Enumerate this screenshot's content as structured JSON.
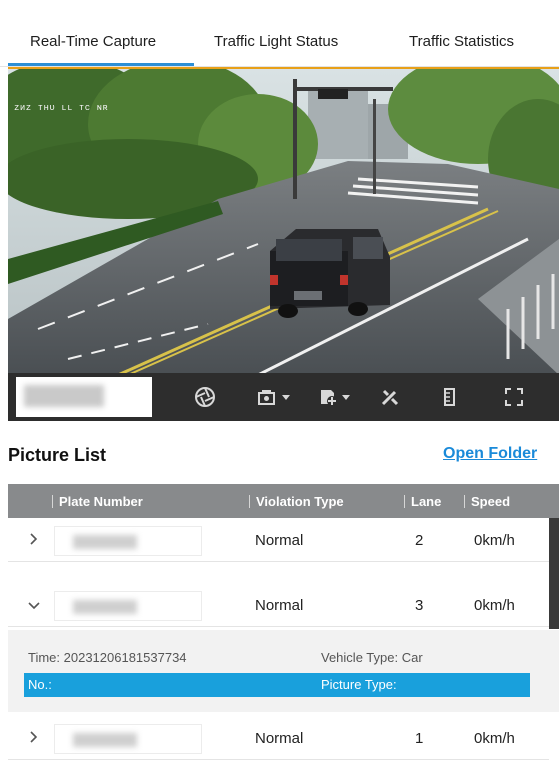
{
  "tabs": {
    "items": [
      {
        "label": "Real-Time Capture"
      },
      {
        "label": "Traffic Light Status"
      },
      {
        "label": "Traffic Statistics"
      }
    ],
    "active_index": 0
  },
  "video": {
    "osd_text": "ᴢᴎᴢ ᴛʜᴜ ʟʟ ᴛᴄ ɴʀ"
  },
  "toolbar": {
    "icons": [
      "shutter-icon",
      "snapshot-icon",
      "add-capture-icon",
      "tools-icon",
      "ruler-icon",
      "fullscreen-icon"
    ]
  },
  "picture_list": {
    "title": "Picture List",
    "open_folder": "Open Folder",
    "columns": [
      "Plate Number",
      "Violation Type",
      "Lane",
      "Speed"
    ],
    "rows": [
      {
        "violation": "Normal",
        "lane": "2",
        "speed": "0km/h",
        "expanded": false
      },
      {
        "violation": "Normal",
        "lane": "3",
        "speed": "0km/h",
        "expanded": true
      },
      {
        "violation": "Normal",
        "lane": "1",
        "speed": "0km/h",
        "expanded": false
      }
    ],
    "details": {
      "time": "Time:  20231206181537734",
      "vehicle_type": "Vehicle Type:  Car",
      "no": "No.:",
      "picture_type": "Picture Type:"
    }
  },
  "colors": {
    "accent": "#2c8fd6",
    "highlight_bar": "#19a0dc",
    "header_bg": "#888a8c",
    "toolbar_bg": "#2d2d2d"
  }
}
